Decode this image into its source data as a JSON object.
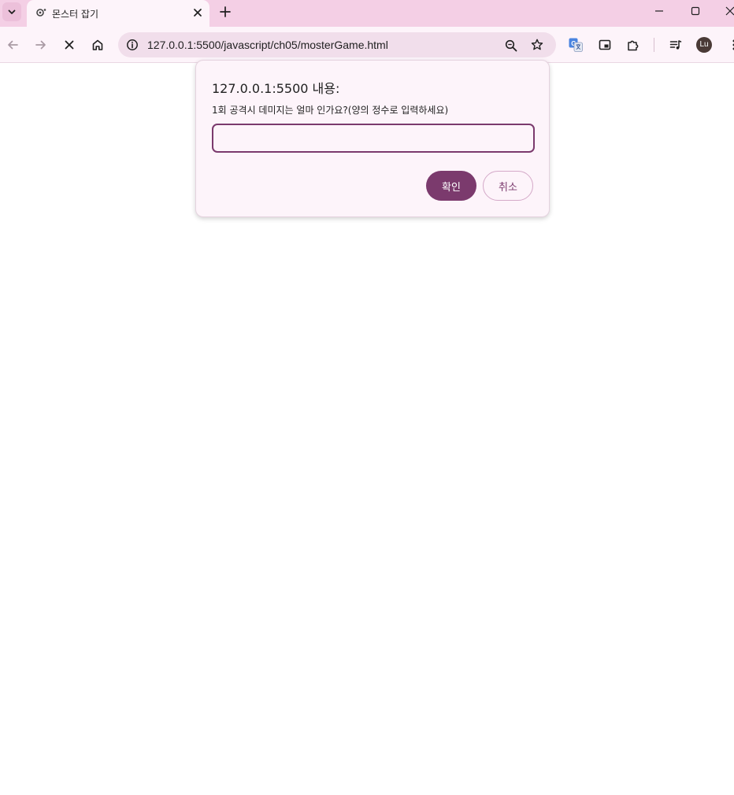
{
  "browser": {
    "tab": {
      "title": "몬스터 잡기",
      "favicon": "page-loading-icon"
    },
    "address_bar": {
      "url": "127.0.0.1:5500/javascript/ch05/mosterGame.html"
    },
    "profile": {
      "initials": "Lu"
    },
    "colors": {
      "frame": "#f4cfe5",
      "toolbar": "#fdf4fa",
      "omnibox": "#f1deeb",
      "accent": "#7b3a6d"
    }
  },
  "dialog": {
    "title": "127.0.0.1:5500 내용:",
    "message": "1회 공격시 데미지는 얼마 인가요?(양의 정수로 입력하세요)",
    "input_value": "",
    "ok_label": "확인",
    "cancel_label": "취소"
  }
}
